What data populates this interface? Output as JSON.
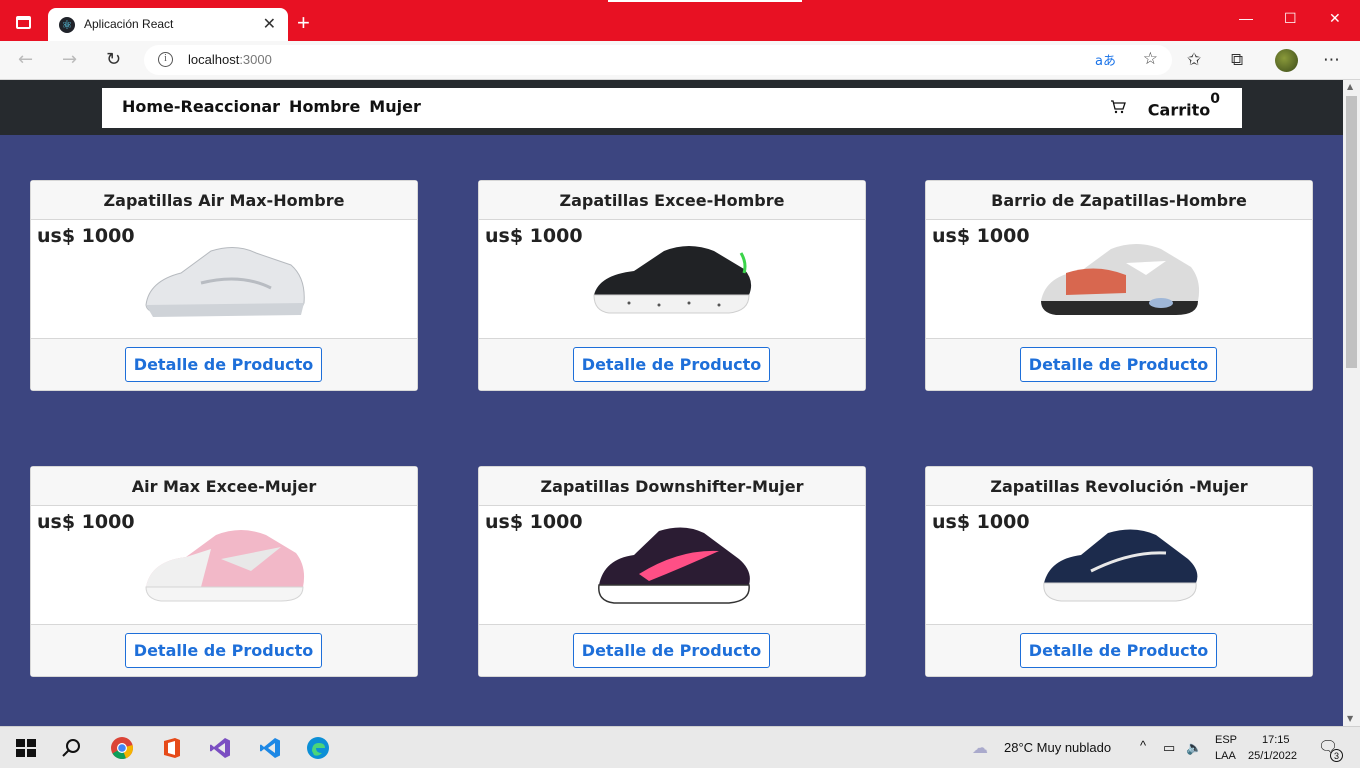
{
  "browser": {
    "tab_title": "Aplicación React",
    "tab_close": "✕",
    "new_tab": "+",
    "url_host": "localhost",
    "url_port": ":3000",
    "window_controls": [
      "—",
      "☐",
      "✕"
    ]
  },
  "nav": {
    "links": [
      "Home-Reaccionar",
      "Hombre",
      "Mujer"
    ],
    "cart_label": "Carrito",
    "cart_count": "0"
  },
  "products": [
    {
      "title": "Zapatillas Air Max-Hombre",
      "price": "us$ 1000",
      "button": "Detalle de Producto",
      "shoe": "white-sneaker"
    },
    {
      "title": "Zapatillas Excee-Hombre",
      "price": "us$ 1000",
      "button": "Detalle de Producto",
      "shoe": "black-sneaker"
    },
    {
      "title": "Barrio de Zapatillas-Hombre",
      "price": "us$ 1000",
      "button": "Detalle de Producto",
      "shoe": "multicolor-sneaker"
    },
    {
      "title": "Air Max Excee-Mujer",
      "price": "us$ 1000",
      "button": "Detalle de Producto",
      "shoe": "pink-sneaker"
    },
    {
      "title": "Zapatillas Downshifter-Mujer",
      "price": "us$ 1000",
      "button": "Detalle de Producto",
      "shoe": "purple-sneaker"
    },
    {
      "title": "Zapatillas Revolución -Mujer",
      "price": "us$ 1000",
      "button": "Detalle de Producto",
      "shoe": "navy-sneaker"
    }
  ],
  "taskbar": {
    "weather": "28°C  Muy nublado",
    "lang_top": "ESP",
    "lang_bottom": "LAA",
    "time": "17:15",
    "date": "25/1/2022",
    "notifications": "3"
  },
  "colors": {
    "accent": "#e81123",
    "page_bg": "#3c4580",
    "link_blue": "#1e6fd9"
  }
}
